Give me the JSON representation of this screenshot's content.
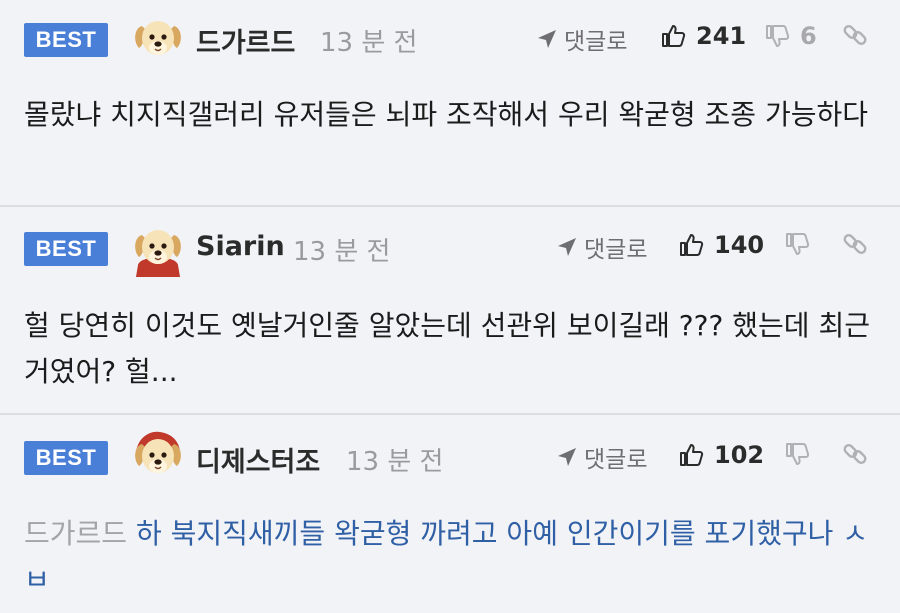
{
  "comments": [
    {
      "badge": "BEST",
      "nickname": "드가르드",
      "time": "13 분 전",
      "reply_label": "댓글로",
      "likes": "241",
      "dislikes": "6",
      "text": "몰랐냐 치지직갤러리 유저들은 뇌파 조작해서 우리 왁굳형 조종 가능하다",
      "avatar_icon": "puppy-avatar-icon"
    },
    {
      "badge": "BEST",
      "nickname": "Siarin",
      "time": "13 분 전",
      "reply_label": "댓글로",
      "likes": "140",
      "dislikes": "",
      "text": "헐 당연히 이것도 옛날거인줄 알았는데 선관위 보이길래 ??? 했는데 최근거였어? 헐...",
      "avatar_icon": "puppy-red-cape-avatar-icon"
    },
    {
      "badge": "BEST",
      "nickname": "디제스터조",
      "time": "13 분 전",
      "reply_label": "댓글로",
      "likes": "102",
      "dislikes": "",
      "mention": "드가르드",
      "text": "하 북지직새끼들 왁굳형 까려고 아예 인간이기를 포기했구나 ㅅㅂ",
      "avatar_icon": "puppy-red-hood-avatar-icon"
    }
  ],
  "colors": {
    "background": "#f2f3f7",
    "best_badge": "#4a7fd8",
    "reply_text": "#2f5fa5",
    "muted": "#9a9aa0"
  }
}
